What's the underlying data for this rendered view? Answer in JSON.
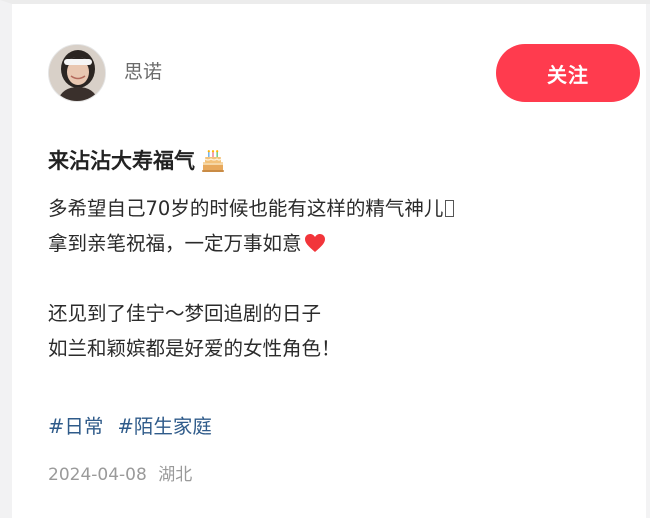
{
  "author": {
    "name": "思诺",
    "avatar": "avatar-photo"
  },
  "follow_button": {
    "label": "关注",
    "color": "#ff3b4e"
  },
  "post": {
    "title": "来沾沾大寿福气",
    "title_emoji": "birthday-cake-icon",
    "lines": [
      "多希望自己70岁的时候也能有这样的精气神儿",
      "拿到亲笔祝福，一定万事如意",
      "",
      "还见到了佳宁～梦回追剧的日子",
      "如兰和颖嫔都是好爱的女性角色！"
    ]
  },
  "tags": [
    "#日常",
    "#陌生家庭"
  ],
  "meta": {
    "date": "2024-04-08",
    "location": "湖北"
  },
  "colors": {
    "accent": "#ff3b4e",
    "tag": "#2f5b8a",
    "heart": "#ff3b3b"
  }
}
